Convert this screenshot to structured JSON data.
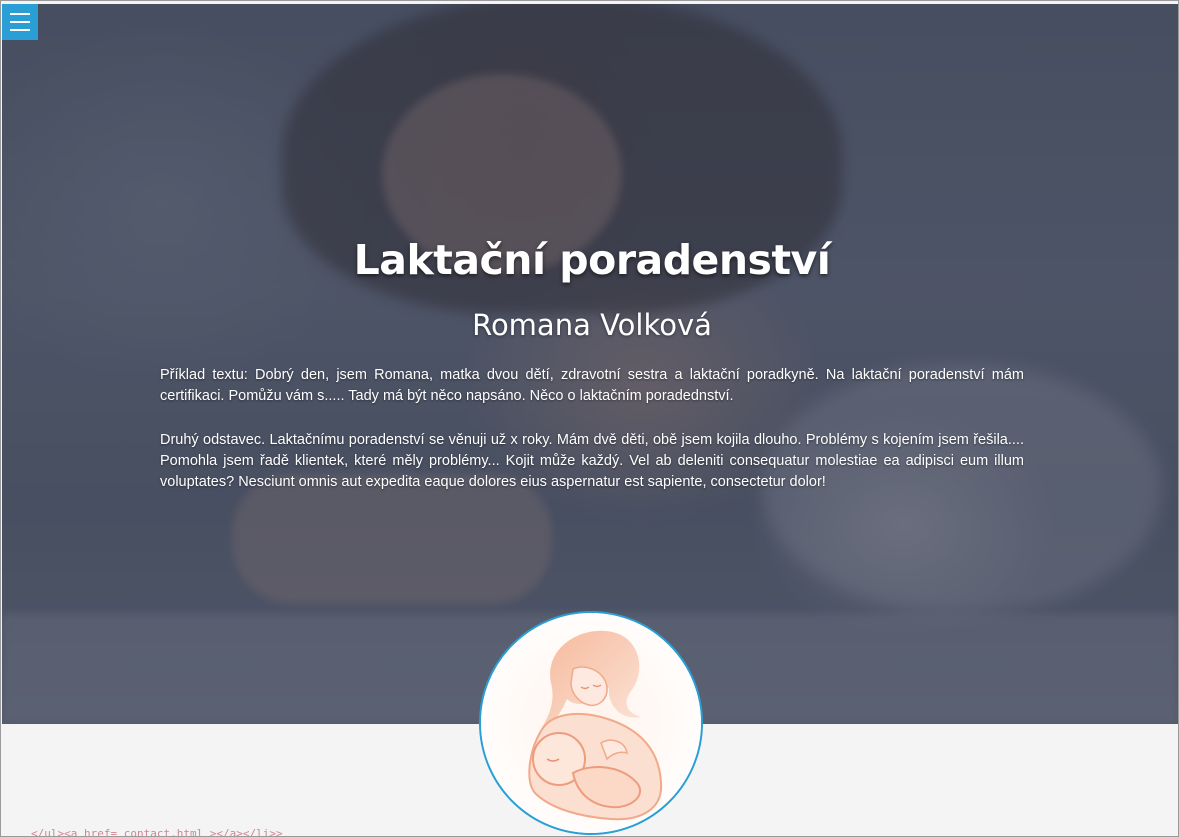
{
  "menu": {
    "icon": "hamburger-menu-icon",
    "accent": "#2a9fd6"
  },
  "hero": {
    "title": "Laktační poradenství",
    "subtitle": "Romana Volková",
    "paragraphs": [
      "Příklad textu: Dobrý den, jsem Romana, matka dvou dětí, zdravotní sestra a laktační poradkyně. Na laktační poradenství mám certifikaci. Pomůžu vám s..... Tady má být něco napsáno. Něco o laktačním poradednství.",
      "Druhý odstavec. Laktačnímu poradenství se věnuji už x roky. Mám dvě děti, obě jsem kojila dlouho. Problémy s kojením jsem řešila.... Pomohla jsem řadě klientek, které měly problémy... Kojit může každý. Vel ab deleniti consequatur molestiae ea adipisci eum illum voluptates? Nesciunt omnis aut expedita eaque dolores eius aspernatur est sapiente, consectetur dolor!"
    ]
  },
  "logo": {
    "icon": "breastfeeding-mother-logo",
    "color": "#f2a98a"
  }
}
